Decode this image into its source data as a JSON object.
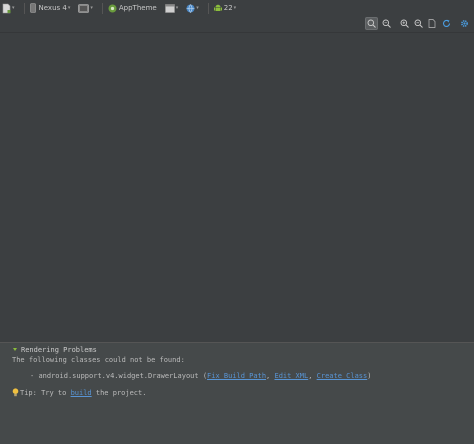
{
  "toolbar": {
    "device": "Nexus 4",
    "theme": "AppTheme",
    "api": "22"
  },
  "problems": {
    "title": "Rendering Problems",
    "intro": "The following classes could not be found:",
    "bullet": "-",
    "class_name": "android.support.v4.widget.DrawerLayout",
    "open_paren": "(",
    "fix_link": "Fix Build Path",
    "sep1": ",",
    "edit_link": "Edit XML",
    "sep2": ",",
    "create_link": "Create Class",
    "close_paren": ")",
    "tip_prefix": "Tip: Try to",
    "tip_link": "build",
    "tip_suffix": "the project."
  }
}
